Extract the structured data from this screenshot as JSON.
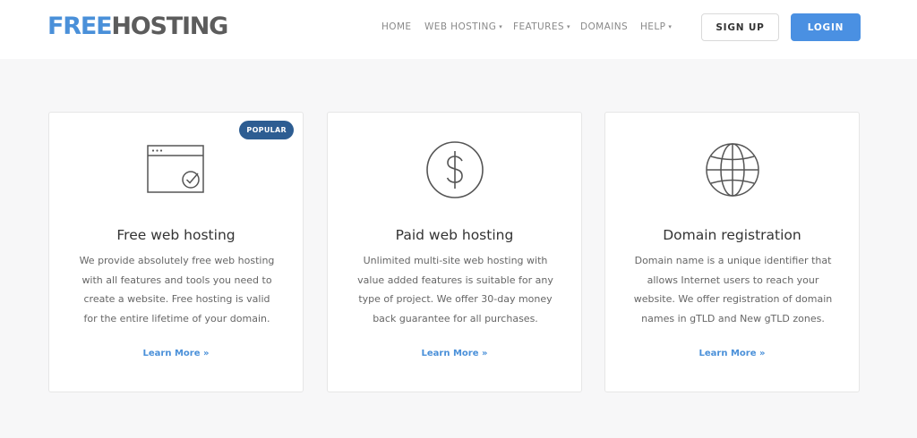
{
  "brand": {
    "part1": "FREE",
    "part2": "HOSTING",
    "colors": {
      "accent": "#4a90d9",
      "dark": "#5c5c5c"
    }
  },
  "nav": {
    "items": [
      {
        "label": "HOME",
        "caret": ""
      },
      {
        "label": "WEB HOSTING",
        "caret": "▾"
      },
      {
        "label": "FEATURES",
        "caret": "▾"
      },
      {
        "label": "DOMAINS",
        "caret": ""
      },
      {
        "label": "HELP",
        "caret": "▾"
      }
    ],
    "signup_label": "SIGN UP",
    "login_label": "LOGIN"
  },
  "cards": [
    {
      "icon": "browser-check-icon",
      "badge": "POPULAR",
      "title": "Free web hosting",
      "description": "We provide absolutely free web hosting with all features and tools you need to create a website. Free hosting is valid for the entire lifetime of your domain.",
      "link": "Learn More »"
    },
    {
      "icon": "dollar-icon",
      "title": "Paid web hosting",
      "description": "Unlimited multi-site web hosting with value added features is suitable for any type of project. We offer 30-day money back guarantee for all purchases.",
      "link": "Learn More »"
    },
    {
      "icon": "globe-icon",
      "title": "Domain registration",
      "description": "Domain name is a unique identifier that allows Internet users to reach your website. We offer registration of domain names in gTLD and New gTLD zones.",
      "link": "Learn More »"
    }
  ]
}
